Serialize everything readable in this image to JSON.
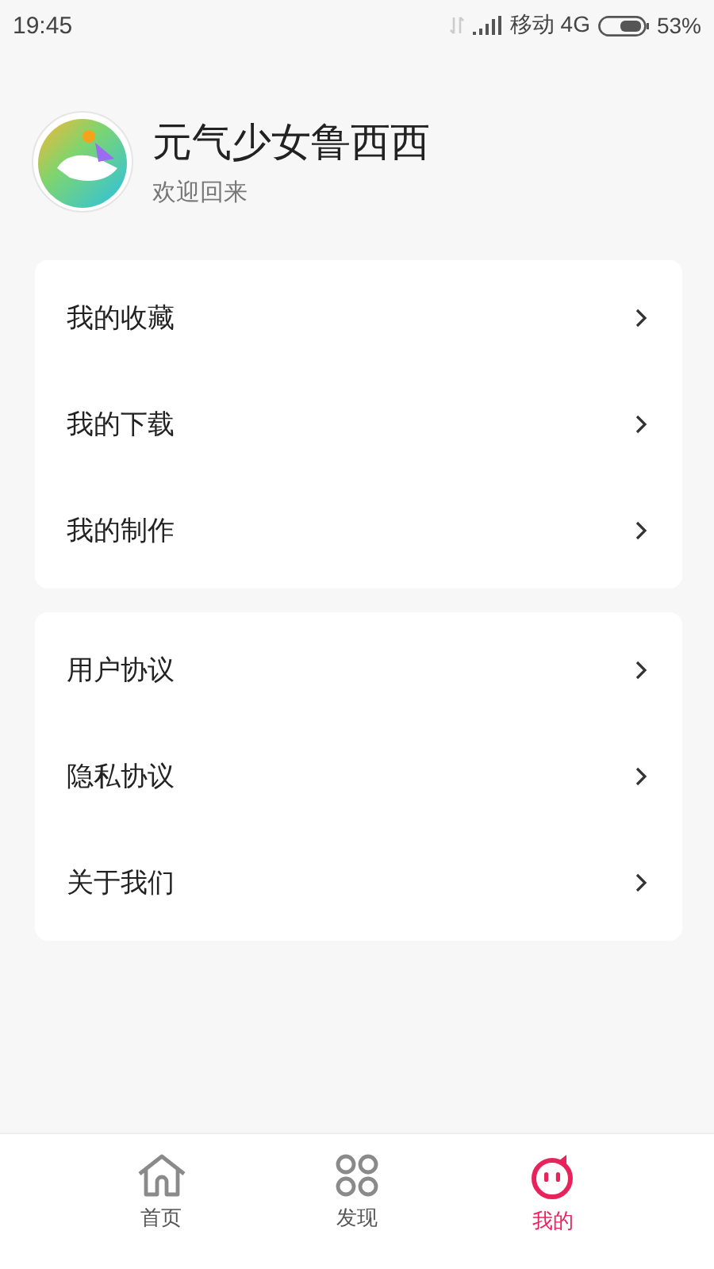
{
  "status_bar": {
    "time": "19:45",
    "carrier": "移动 4G",
    "battery": "53%"
  },
  "profile": {
    "name": "元气少女鲁西西",
    "greeting": "欢迎回来"
  },
  "menu_groups": [
    {
      "items": [
        {
          "label": "我的收藏"
        },
        {
          "label": "我的下载"
        },
        {
          "label": "我的制作"
        }
      ]
    },
    {
      "items": [
        {
          "label": "用户协议"
        },
        {
          "label": "隐私协议"
        },
        {
          "label": "关于我们"
        }
      ]
    }
  ],
  "tab_bar": [
    {
      "label": "首页",
      "kind": "home",
      "selected": false
    },
    {
      "label": "发现",
      "kind": "grid",
      "selected": false
    },
    {
      "label": "我的",
      "kind": "face",
      "selected": true
    }
  ]
}
